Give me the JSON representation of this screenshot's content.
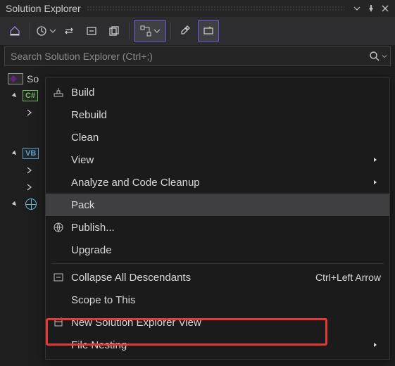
{
  "panel": {
    "title": "Solution Explorer"
  },
  "search": {
    "placeholder": "Search Solution Explorer (Ctrl+;)"
  },
  "tree": {
    "root_label_prefix": "So",
    "cs_badge": "C#",
    "vb_badge": "VB"
  },
  "menu": {
    "items": [
      {
        "label": "Build"
      },
      {
        "label": "Rebuild"
      },
      {
        "label": "Clean"
      },
      {
        "label": "View",
        "submenu": true
      },
      {
        "label": "Analyze and Code Cleanup",
        "submenu": true
      },
      {
        "label": "Pack",
        "hover": true
      },
      {
        "label": "Publish..."
      },
      {
        "label": "Upgrade"
      },
      {
        "label": "Collapse All Descendants",
        "shortcut": "Ctrl+Left Arrow",
        "icon": "collapse"
      },
      {
        "label": "Scope to This"
      },
      {
        "label": "New Solution Explorer View",
        "icon": "new-view",
        "highlighted": true
      },
      {
        "label": "File Nesting",
        "submenu": true
      }
    ]
  }
}
